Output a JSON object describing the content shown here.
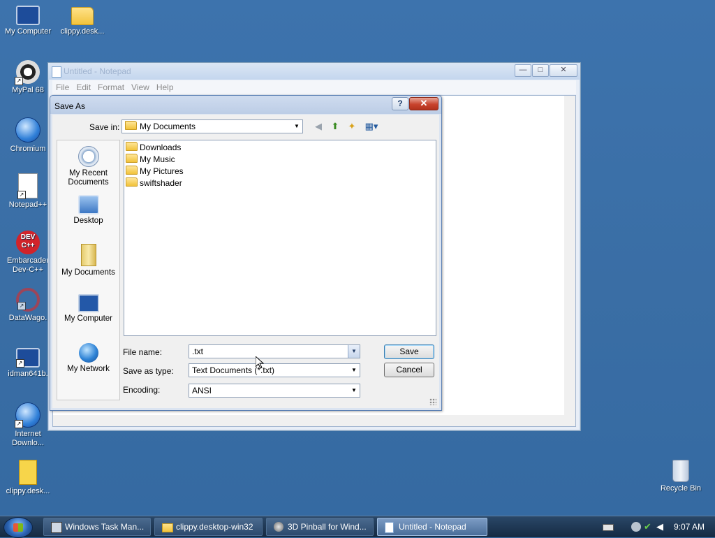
{
  "desktop": {
    "icons": [
      {
        "label": "My Computer",
        "icon": "my-computer-icon"
      },
      {
        "label": "clippy.desk...",
        "icon": "folder-icon"
      },
      {
        "label": "MyPal 68",
        "icon": "mypal-icon"
      },
      {
        "label": "Chromium",
        "icon": "chromium-icon"
      },
      {
        "label": "Notepad++",
        "icon": "notepadpp-icon"
      },
      {
        "label": "Embarcader Dev-C++",
        "icon": "devcpp-icon",
        "badge": "DEV C++"
      },
      {
        "label": "DataWago.",
        "icon": "datawago-icon"
      },
      {
        "label": "idman641b.",
        "icon": "installer-icon"
      },
      {
        "label": "Internet Downlo...",
        "icon": "idm-icon"
      },
      {
        "label": "clippy.desk...",
        "icon": "zip-archive-icon"
      },
      {
        "label": "Recycle Bin",
        "icon": "recycle-bin-icon"
      }
    ]
  },
  "notepad": {
    "title": "Untitled - Notepad",
    "menu": [
      "File",
      "Edit",
      "Format",
      "View",
      "Help"
    ],
    "controls": {
      "minimize": "—",
      "maximize": "□",
      "close": "✕"
    }
  },
  "save_dialog": {
    "title": "Save As",
    "help": "?",
    "close": "✕",
    "save_in_label": "Save in:",
    "save_in_value": "My Documents",
    "places": [
      {
        "label": "My Recent Documents",
        "icon": "recent-documents-icon"
      },
      {
        "label": "Desktop",
        "icon": "desktop-icon"
      },
      {
        "label": "My Documents",
        "icon": "my-documents-icon"
      },
      {
        "label": "My Computer",
        "icon": "my-computer-icon"
      },
      {
        "label": "My Network",
        "icon": "network-icon"
      }
    ],
    "files": [
      "Downloads",
      "My Music",
      "My Pictures",
      "swiftshader"
    ],
    "file_name_label": "File name:",
    "file_name_value": ".txt",
    "save_as_type_label": "Save as type:",
    "save_as_type_value": "Text Documents (*.txt)",
    "encoding_label": "Encoding:",
    "encoding_value": "ANSI",
    "save_button": "Save",
    "cancel_button": "Cancel"
  },
  "taskbar": {
    "tasks": [
      {
        "label": "Windows Task Man...",
        "icon": "task-manager-icon",
        "active": false
      },
      {
        "label": "clippy.desktop-win32",
        "icon": "folder-icon",
        "active": false
      },
      {
        "label": "3D Pinball for Wind...",
        "icon": "pinball-icon",
        "active": false
      },
      {
        "label": "Untitled - Notepad",
        "icon": "notepad-icon",
        "active": true
      }
    ],
    "clock": "9:07 AM"
  }
}
